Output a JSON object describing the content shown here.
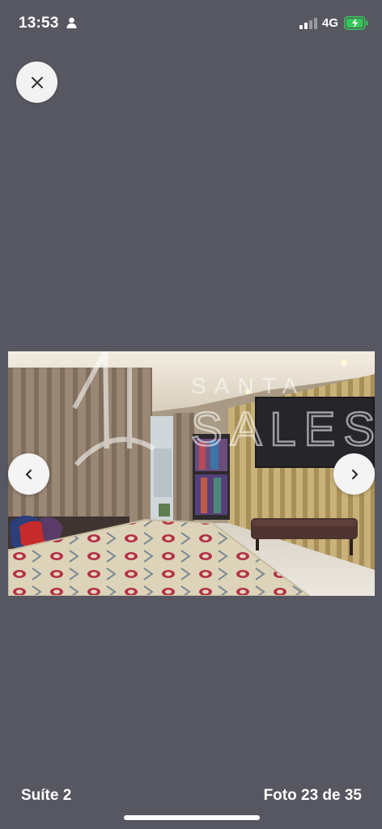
{
  "status_bar": {
    "time": "13:53",
    "network": "4G",
    "icons": [
      "person-icon",
      "signal-icon",
      "battery-charging-icon"
    ],
    "battery_color": "#34c759"
  },
  "viewer": {
    "close_icon": "close-icon",
    "prev_icon": "chevron-left-icon",
    "next_icon": "chevron-right-icon",
    "watermark_line1": "SANTA",
    "watermark_line2": "SALES",
    "background_color": "#575762"
  },
  "footer": {
    "caption": "Suíte 2",
    "counter": "Foto 23 de 35"
  }
}
